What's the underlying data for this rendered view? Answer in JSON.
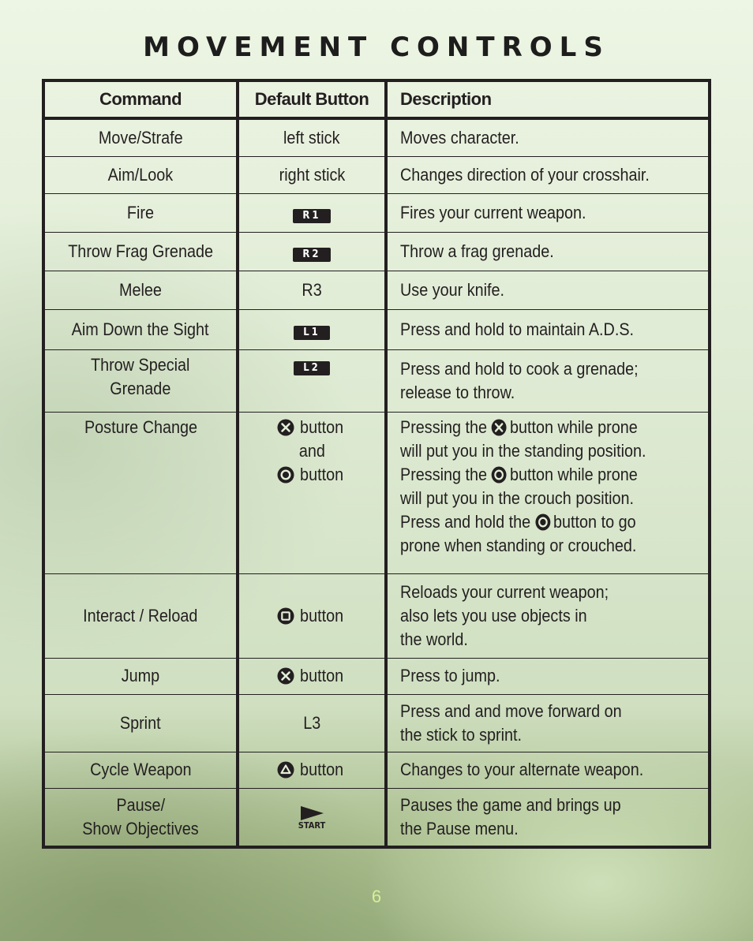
{
  "title": "MOVEMENT CONTROLS",
  "columns": {
    "command": "Command",
    "button": "Default Button",
    "description": "Description"
  },
  "rows": [
    {
      "command": "Move/Strafe",
      "button": {
        "type": "text",
        "text": "left stick"
      },
      "description": "Moves character."
    },
    {
      "command": "Aim/Look",
      "button": {
        "type": "text",
        "text": "right stick"
      },
      "description": "Changes direction of your crosshair."
    },
    {
      "command": "Fire",
      "button": {
        "type": "badge",
        "text": "R1"
      },
      "description": "Fires your current weapon."
    },
    {
      "command": "Throw Frag Grenade",
      "button": {
        "type": "badge",
        "text": "R2"
      },
      "description": "Throw a frag grenade."
    },
    {
      "command": "Melee",
      "button": {
        "type": "text",
        "text": "R3"
      },
      "description": "Use your knife."
    },
    {
      "command": "Aim Down the Sight",
      "button": {
        "type": "badge",
        "text": "L1"
      },
      "description": "Press and hold to maintain A.D.S."
    },
    {
      "command_lines": [
        "Throw Special",
        "Grenade"
      ],
      "button": {
        "type": "badge",
        "text": "L2"
      },
      "description_lines": [
        "Press and hold to cook a grenade;",
        "release to throw."
      ]
    },
    {
      "command": "Posture Change",
      "button_lines": [
        {
          "icon": "cross-button-icon",
          "text": "button"
        },
        {
          "text": "and"
        },
        {
          "icon": "circle-button-icon",
          "text": "button"
        }
      ],
      "description_lines": [
        {
          "before": "Pressing the",
          "icon": "cross-button-icon",
          "after": "button while prone"
        },
        {
          "before": "will put you in the standing position."
        },
        {
          "before": "Pressing the",
          "icon": "circle-button-icon",
          "after": "button while prone"
        },
        {
          "before": "will put you in the crouch position."
        },
        {
          "before": "Press and hold the",
          "icon": "circle-button-icon",
          "after": "button to go"
        },
        {
          "before": "prone when standing or crouched."
        }
      ]
    },
    {
      "command": "Interact / Reload",
      "button": {
        "type": "icon",
        "icon": "square-button-icon",
        "text": "button"
      },
      "description_lines": [
        "Reloads your current weapon;",
        "also lets you use objects in",
        "the world."
      ]
    },
    {
      "command": "Jump",
      "button": {
        "type": "icon",
        "icon": "cross-button-icon",
        "text": "button"
      },
      "description": "Press to jump."
    },
    {
      "command": "Sprint",
      "button": {
        "type": "text",
        "text": "L3"
      },
      "description_lines": [
        "Press and and move forward on",
        "the stick to sprint."
      ]
    },
    {
      "command": "Cycle Weapon",
      "button": {
        "type": "icon",
        "icon": "triangle-button-icon",
        "text": "button"
      },
      "description": "Changes to your alternate weapon."
    },
    {
      "command_lines": [
        "Pause/",
        "Show Objectives"
      ],
      "button": {
        "type": "start",
        "text": "START"
      },
      "description_lines": [
        "Pauses the game and brings up",
        "the Pause menu."
      ]
    }
  ],
  "page_number": "6",
  "colors": {
    "ink": "#231f20",
    "page_number": "#d6ef9a"
  }
}
